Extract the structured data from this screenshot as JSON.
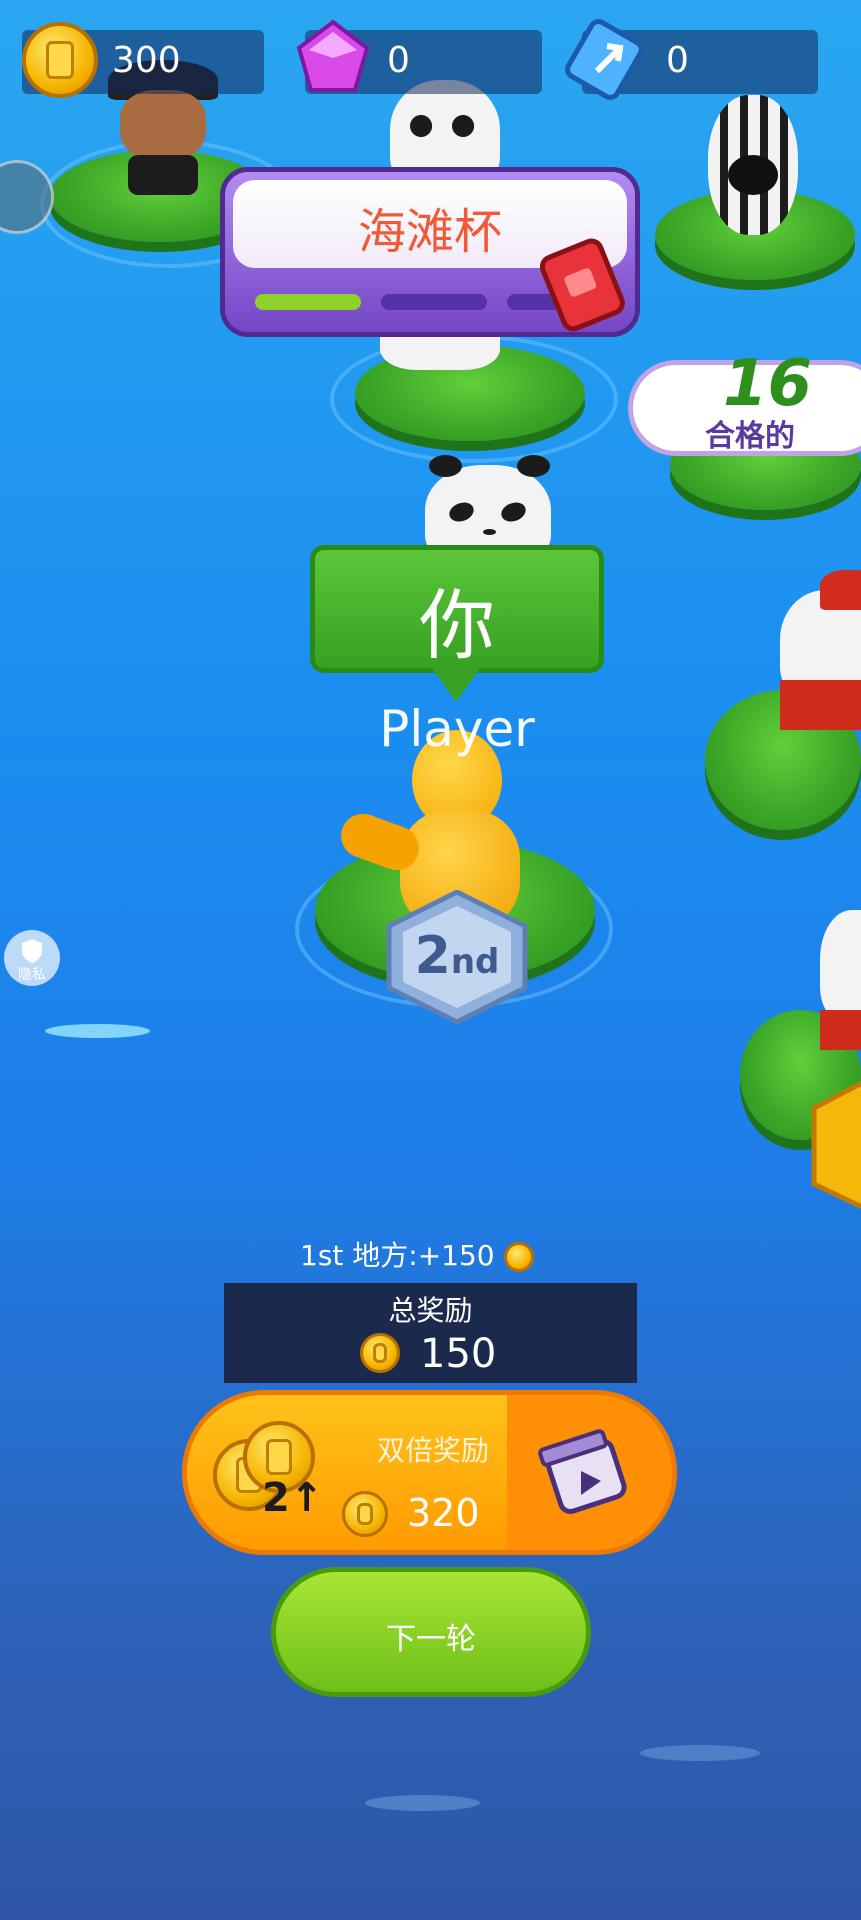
{
  "hud": {
    "coins": "300",
    "gems": "0",
    "tickets": "0"
  },
  "cup": {
    "title": "海滩杯",
    "progress_segments_filled": 1,
    "progress_segments_total": 3
  },
  "qualified": {
    "count": "16",
    "label": "合格的"
  },
  "player": {
    "you_label": "你",
    "name": "Player",
    "rank_number": "2",
    "rank_suffix": "nd"
  },
  "privacy": {
    "label": "隐私"
  },
  "rewards": {
    "place_line": "1st 地方:+150",
    "total_label": "总奖励",
    "total_value": "150",
    "double_label": "双倍奖励",
    "double_multiplier": "2↑",
    "double_value": "320",
    "next_label": "下一轮"
  },
  "colors": {
    "water": "#1b8ff0",
    "pad": "#3aa526",
    "banner": "#7446c6",
    "cup_title": "#f05a37",
    "double_btn": "#ff9b00",
    "next_btn": "#6fbf19"
  }
}
